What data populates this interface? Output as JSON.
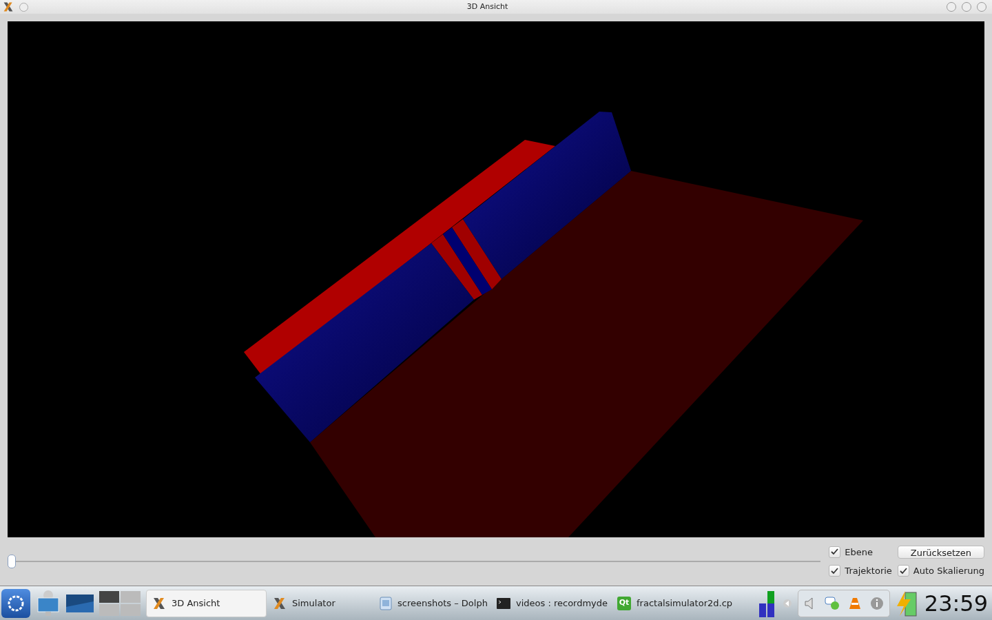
{
  "window": {
    "title": "3D Ansicht"
  },
  "controls": {
    "slider": {
      "level": 0.0
    },
    "checkboxes": [
      {
        "label": "Ebene",
        "checked": true
      },
      {
        "label": "Trajektorie",
        "checked": true
      },
      {
        "label": "Auto Skalierung",
        "checked": true
      }
    ],
    "reset_button": "Zurücksetzen"
  },
  "taskbar": {
    "tasks": [
      {
        "label": "3D Ansicht",
        "kind": "kx",
        "selected": true
      },
      {
        "label": "Simulator",
        "kind": "kx",
        "selected": false
      },
      {
        "label": "screenshots – Dolph",
        "kind": "folder",
        "selected": false
      },
      {
        "label": "videos : recordmyde",
        "kind": "terminal",
        "selected": false
      },
      {
        "label": "fractalsimulator2d.cp",
        "kind": "qt",
        "icon_text": "Qt",
        "selected": false
      }
    ],
    "clock": "23:59"
  }
}
